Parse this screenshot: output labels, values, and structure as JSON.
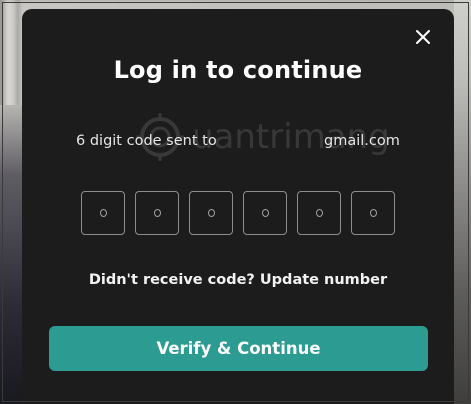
{
  "modal": {
    "title": "Log in to continue",
    "sent_prefix": "6 digit code sent to",
    "sent_email_suffix": "gmail.com",
    "otp_digits": [
      "",
      "",
      "",
      "",
      "",
      ""
    ],
    "resend_text": "Didn't receive code?",
    "update_link": "Update number",
    "verify_label": "Verify & Continue",
    "close_icon": "close-icon"
  },
  "watermark": {
    "text": "uantrimang"
  },
  "colors": {
    "modal_bg": "#1c1c1d",
    "accent": "#2c9b92",
    "text": "#ffffff",
    "otp_border": "#8d8d90"
  }
}
